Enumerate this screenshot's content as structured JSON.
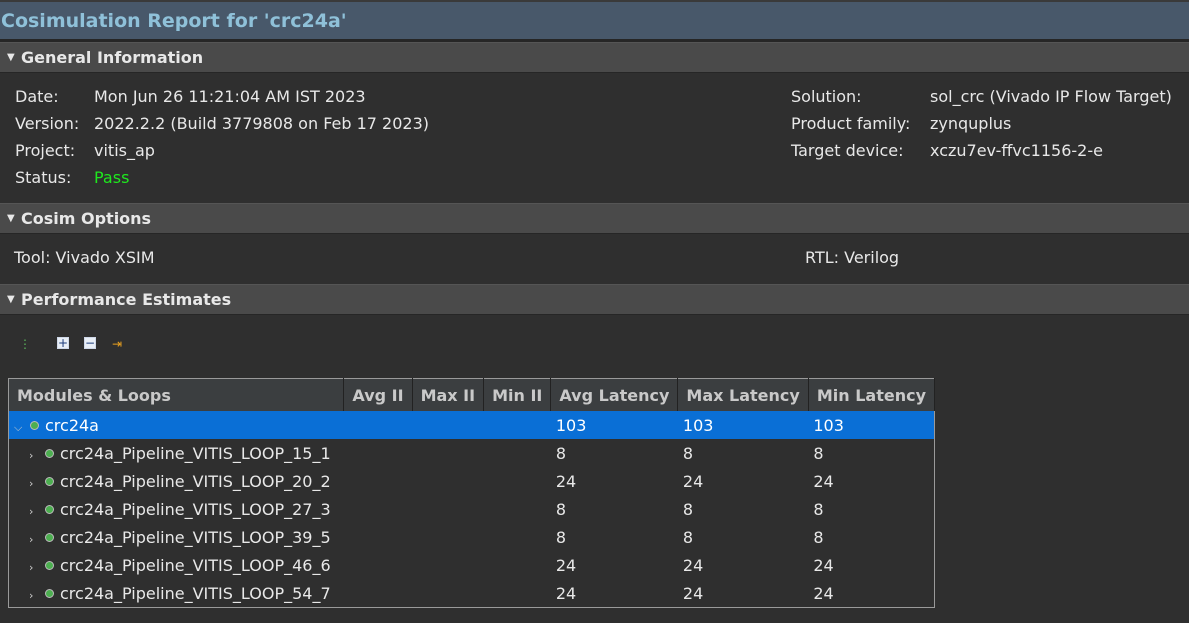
{
  "title": "Cosimulation Report for 'crc24a'",
  "general": {
    "header": "General Information",
    "left": [
      {
        "label": "Date:",
        "value": "Mon Jun 26 11:21:04 AM IST 2023"
      },
      {
        "label": "Version:",
        "value": "2022.2.2 (Build 3779808 on Feb 17 2023)"
      },
      {
        "label": "Project:",
        "value": "vitis_ap"
      },
      {
        "label": "Status:",
        "value": "Pass"
      }
    ],
    "right": [
      {
        "label": "Solution:",
        "value": "sol_crc (Vivado IP Flow Target)"
      },
      {
        "label": "Product family:",
        "value": "zynquplus"
      },
      {
        "label": "Target device:",
        "value": "xczu7ev-ffvc1156-2-e"
      }
    ]
  },
  "cosim": {
    "header": "Cosim Options",
    "tool": "Tool: Vivado XSIM",
    "rtl": "RTL: Verilog"
  },
  "perf": {
    "header": "Performance Estimates",
    "columns": [
      "Modules & Loops",
      "Avg II",
      "Max II",
      "Min II",
      "Avg Latency",
      "Max Latency",
      "Min Latency"
    ],
    "rows": [
      {
        "name": "crc24a",
        "avg_ii": "",
        "max_ii": "",
        "min_ii": "",
        "avg_lat": "103",
        "max_lat": "103",
        "min_lat": "103"
      },
      {
        "name": "crc24a_Pipeline_VITIS_LOOP_15_1",
        "avg_ii": "",
        "max_ii": "",
        "min_ii": "",
        "avg_lat": "8",
        "max_lat": "8",
        "min_lat": "8"
      },
      {
        "name": "crc24a_Pipeline_VITIS_LOOP_20_2",
        "avg_ii": "",
        "max_ii": "",
        "min_ii": "",
        "avg_lat": "24",
        "max_lat": "24",
        "min_lat": "24"
      },
      {
        "name": "crc24a_Pipeline_VITIS_LOOP_27_3",
        "avg_ii": "",
        "max_ii": "",
        "min_ii": "",
        "avg_lat": "8",
        "max_lat": "8",
        "min_lat": "8"
      },
      {
        "name": "crc24a_Pipeline_VITIS_LOOP_39_5",
        "avg_ii": "",
        "max_ii": "",
        "min_ii": "",
        "avg_lat": "8",
        "max_lat": "8",
        "min_lat": "8"
      },
      {
        "name": "crc24a_Pipeline_VITIS_LOOP_46_6",
        "avg_ii": "",
        "max_ii": "",
        "min_ii": "",
        "avg_lat": "24",
        "max_lat": "24",
        "min_lat": "24"
      },
      {
        "name": "crc24a_Pipeline_VITIS_LOOP_54_7",
        "avg_ii": "",
        "max_ii": "",
        "min_ii": "",
        "avg_lat": "24",
        "max_lat": "24",
        "min_lat": "24"
      }
    ]
  }
}
